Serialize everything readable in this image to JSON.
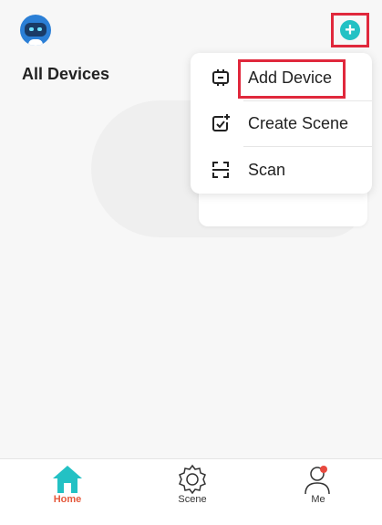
{
  "header": {
    "title": "All Devices"
  },
  "menu": {
    "items": [
      {
        "label": "Add Device",
        "icon": "add-device-icon"
      },
      {
        "label": "Create Scene",
        "icon": "create-scene-icon"
      },
      {
        "label": "Scan",
        "icon": "scan-icon"
      }
    ]
  },
  "tabs": [
    {
      "label": "Home",
      "icon": "home-icon",
      "active": true
    },
    {
      "label": "Scene",
      "icon": "scene-gear-icon",
      "active": false
    },
    {
      "label": "Me",
      "icon": "profile-icon",
      "active": false
    }
  ],
  "colors": {
    "accent": "#23c1c4",
    "active_tab": "#e55a3d",
    "highlight": "#e0283c",
    "badge": "#e8493f"
  }
}
